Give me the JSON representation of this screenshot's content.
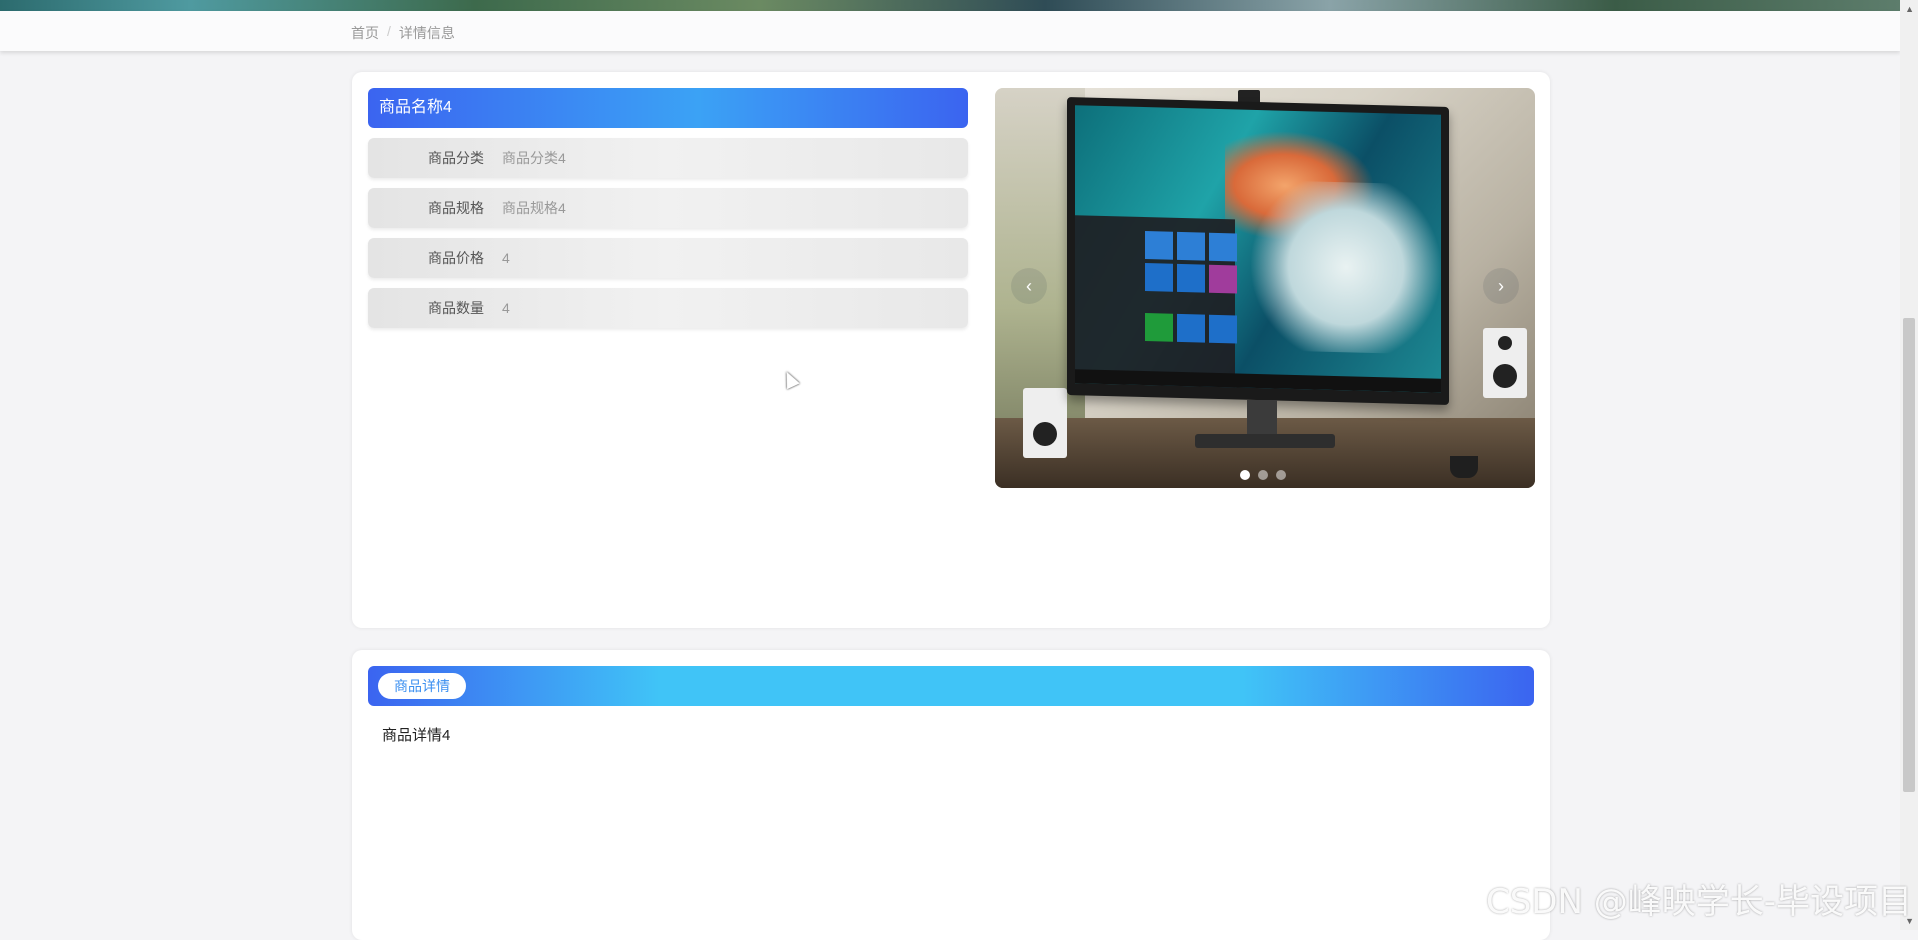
{
  "breadcrumb": {
    "home": "首页",
    "separator": "/",
    "current": "详情信息"
  },
  "product": {
    "title": "商品名称4",
    "fields": [
      {
        "label": "商品分类",
        "value": "商品分类4"
      },
      {
        "label": "商品规格",
        "value": "商品规格4"
      },
      {
        "label": "商品价格",
        "value": "4"
      },
      {
        "label": "商品数量",
        "value": "4"
      }
    ]
  },
  "carousel": {
    "prev_icon": "chevron-left-icon",
    "next_icon": "chevron-right-icon",
    "prev_glyph": "‹",
    "next_glyph": "›",
    "slide_count": 3,
    "active_index": 0
  },
  "detail": {
    "tab_label": "商品详情",
    "content": "商品详情4"
  },
  "watermark": "CSDN @峰映学长-毕设项目",
  "colors": {
    "accent_blue": "#3b64f0",
    "accent_cyan": "#40c4f7"
  }
}
